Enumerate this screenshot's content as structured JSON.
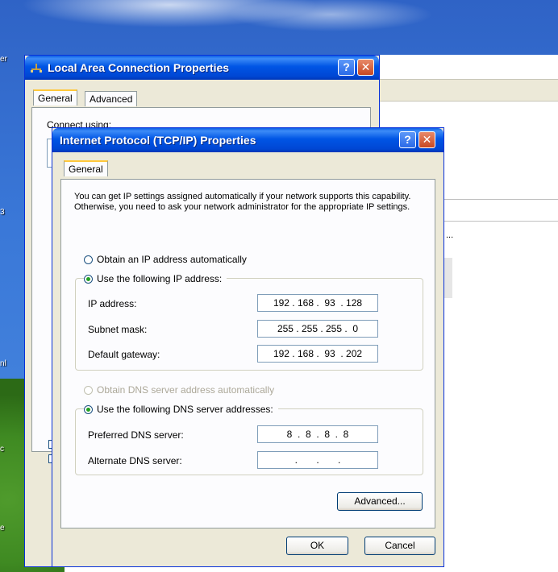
{
  "desktop": {
    "labels": [
      "er",
      "3",
      "nl",
      "c",
      "e"
    ]
  },
  "background_window": {
    "ellipsis": "..."
  },
  "lan_dialog": {
    "title": "Local Area Connection Properties",
    "tabs": [
      "General",
      "Advanced"
    ],
    "connect_using_label": "Connect using:",
    "help_glyph": "?",
    "close_glyph": "✕"
  },
  "tcp_dialog": {
    "title": "Internet Protocol (TCP/IP) Properties",
    "help_glyph": "?",
    "close_glyph": "✕",
    "tab": "General",
    "description": "You can get IP settings assigned automatically if your network supports this capability. Otherwise, you need to ask your network administrator for the appropriate IP settings.",
    "ip_auto_label": "Obtain an IP address automatically",
    "ip_manual_label": "Use the following IP address:",
    "ip_address_label": "IP address:",
    "ip_address": "192 . 168 .  93  . 128",
    "subnet_label": "Subnet mask:",
    "subnet": "255 . 255 . 255 .  0",
    "gateway_label": "Default gateway:",
    "gateway": "192 . 168 .  93  . 202",
    "dns_auto_label": "Obtain DNS server address automatically",
    "dns_manual_label": "Use the following DNS server addresses:",
    "preferred_dns_label": "Preferred DNS server:",
    "preferred_dns": "8  .  8  .  8  .  8",
    "alternate_dns_label": "Alternate DNS server:",
    "alternate_dns": ".       .       .",
    "advanced_button": "Advanced...",
    "ok_button": "OK",
    "cancel_button": "Cancel"
  },
  "selection": {
    "ip_mode": "manual",
    "dns_mode": "manual",
    "accent_green": "#21a121",
    "title_blue": "#0055e5"
  }
}
